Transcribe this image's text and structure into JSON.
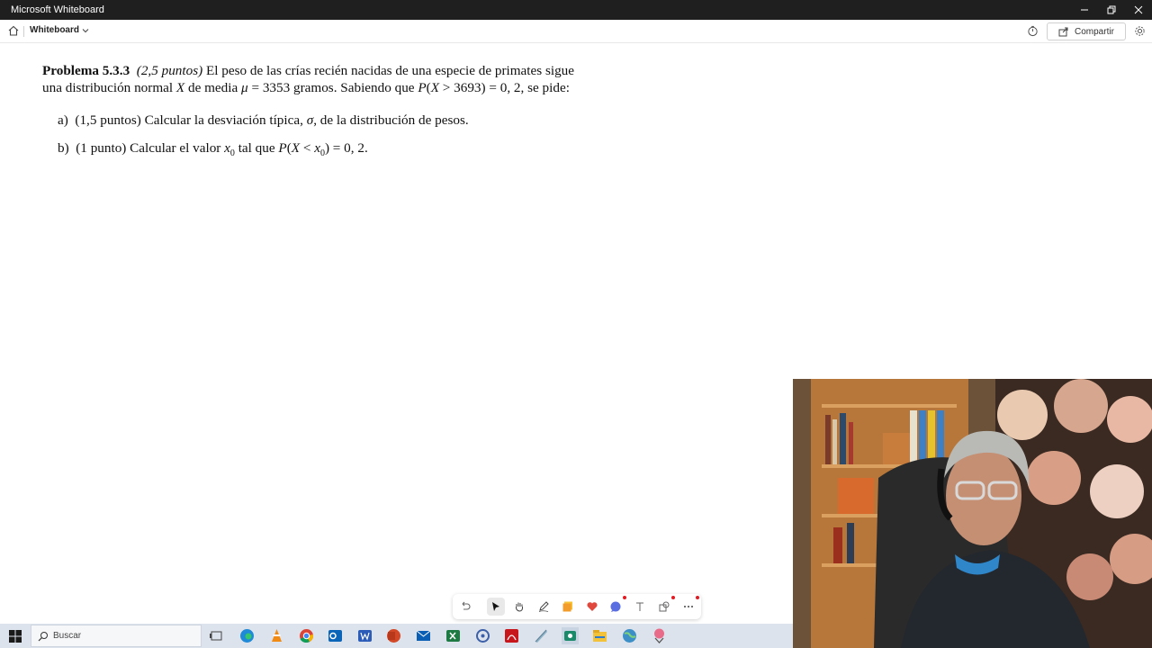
{
  "window": {
    "title": "Microsoft Whiteboard"
  },
  "appbar": {
    "board_name": "Whiteboard",
    "share_label": "Compartir"
  },
  "problem": {
    "heading": "Problema 5.3.3",
    "points": "(2,5 puntos)",
    "line1_text": "El peso de las crías recién nacidas de una especie de primates sigue",
    "line2_a": "una distribución normal",
    "line2_var": "X",
    "line2_b": "de media",
    "line2_mu": "μ",
    "line2_c": "= 3353 gramos. Sabiendo que",
    "line2_P": "P",
    "line2_d": "(",
    "line2_X": "X",
    "line2_e": "> 3693) = 0, 2, se pide:",
    "part_a_label": "a)",
    "part_a_text": "(1,5 puntos) Calcular la desviación típica,",
    "part_a_sigma": "σ",
    "part_a_end": ", de la distribución de pesos.",
    "part_b_label": "b)",
    "part_b_text": "(1 punto) Calcular el valor",
    "part_b_x": "x",
    "part_b_sub": "0",
    "part_b_mid": "tal que",
    "part_b_P": "P",
    "part_b_open": "(",
    "part_b_X": "X",
    "part_b_lt": "<",
    "part_b_x2": "x",
    "part_b_sub2": "0",
    "part_b_end": ") = 0, 2."
  },
  "taskbar": {
    "search_placeholder": "Buscar"
  },
  "toolbar": {
    "tools": [
      "undo-icon",
      "select-icon",
      "hand-icon",
      "pen-icon",
      "sticky-note-icon",
      "reaction-icon",
      "chat-icon",
      "text-icon",
      "shapes-icon",
      "more-icon"
    ]
  },
  "colors": {
    "titlebar": "#1f1f1f",
    "taskbar": "#dde3ec",
    "accent": "#0067c0"
  }
}
